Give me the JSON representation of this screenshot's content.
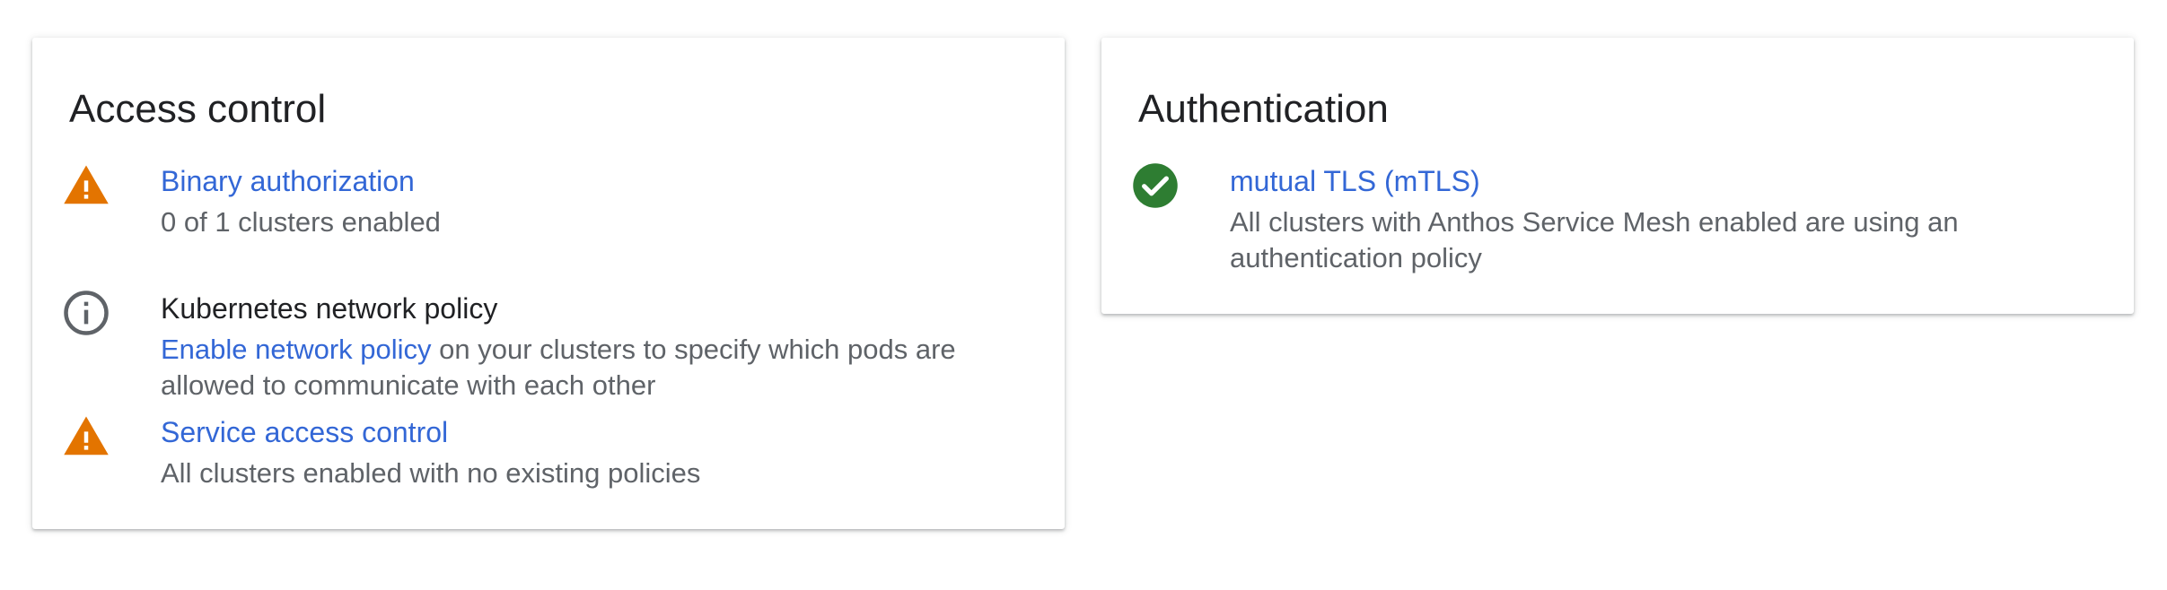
{
  "access_control": {
    "title": "Access control",
    "items": [
      {
        "icon": "warning-icon",
        "title": "Binary authorization",
        "description": "0 of 1 clusters enabled"
      },
      {
        "icon": "info-icon",
        "title": "Kubernetes network policy",
        "link_text": "Enable network policy",
        "description": " on your clusters to specify which pods are allowed to communicate with each other"
      },
      {
        "icon": "warning-icon",
        "title": "Service access control",
        "description": "All clusters enabled with no existing policies"
      }
    ]
  },
  "authentication": {
    "title": "Authentication",
    "items": [
      {
        "icon": "check-circle-icon",
        "title": "mutual TLS (mTLS)",
        "description": "All clusters with Anthos Service Mesh enabled are using an authentication policy"
      }
    ]
  },
  "colors": {
    "link": "#3367d6",
    "warning": "#e37400",
    "success": "#2e7d32",
    "info": "#5f6368",
    "text_primary": "#202124",
    "text_secondary": "#5f6368"
  }
}
